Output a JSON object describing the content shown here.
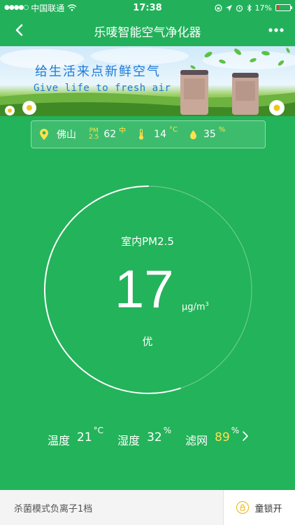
{
  "status_bar": {
    "carrier": "中国联通",
    "time": "17:38",
    "battery": "17%",
    "signal_dots": "●●●●○"
  },
  "nav": {
    "title": "乐唛智能空气净化器"
  },
  "banner": {
    "headline_cn": "给生活来点新鲜空气",
    "headline_en": "Give life to fresh air"
  },
  "info": {
    "city": "佛山",
    "pm_tag_top": "PM",
    "pm_tag_bottom": "2.5",
    "pm_value": "62",
    "pm_level": "中",
    "temperature": "14",
    "temperature_unit": "°C",
    "humidity": "35",
    "humidity_unit": "%"
  },
  "gauge": {
    "title": "室内PM2.5",
    "value": "17",
    "unit": "μg/m",
    "unit_sup": "3",
    "level": "优",
    "fill_fraction": 0.55
  },
  "metrics": {
    "temp_label": "温度",
    "temp_value": "21",
    "temp_unit": "°C",
    "hum_label": "湿度",
    "hum_value": "32",
    "hum_unit": "%",
    "filter_label": "滤网",
    "filter_value": "89",
    "filter_unit": "%"
  },
  "bottom": {
    "mode": "杀菌模式负离子1档",
    "lock_label": "童锁开"
  },
  "colors": {
    "background": "#23b35a",
    "accent_yellow": "#ffe14d",
    "banner_text": "#1e7ad9"
  }
}
